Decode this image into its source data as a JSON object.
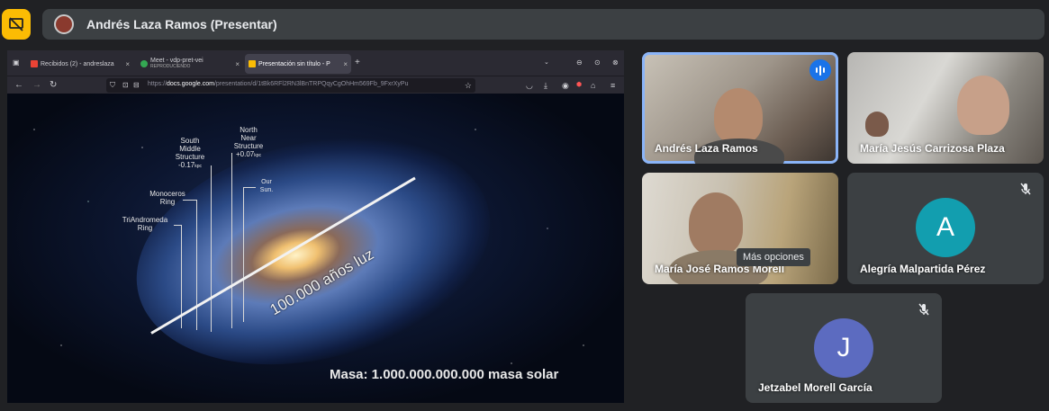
{
  "header": {
    "title": "Andrés Laza Ramos (Presentar)",
    "present_icon": "stop-presenting-icon",
    "accent": "#fbbc04"
  },
  "browser": {
    "tabs": [
      {
        "label": "Recibidos (2) - andreslaza",
        "close": "×",
        "icon": "gmail-icon"
      },
      {
        "label": "Meet - vdp-pret-vei",
        "sublabel": "REPRODUCIENDO",
        "close": "×",
        "icon": "meet-icon"
      },
      {
        "label": "Presentación sin título - P",
        "close": "×",
        "icon": "slides-icon",
        "active": true
      }
    ],
    "new_tab": "+",
    "url_prefix": "https://",
    "url_host": "docs.google.com",
    "url_path": "/presentation/d/1tBk6RFl2RN3lBnTRPQqyCgOhHm569Fb_9FxrXyPu"
  },
  "slide": {
    "labels": {
      "south": "South\nMiddle\nStructure",
      "south_value": "-0.17",
      "south_unit": "kpc",
      "north": "North\nNear\nStructure",
      "north_value": "+0.07",
      "north_unit": "kpc",
      "sun": "Our\nSun.",
      "monoceros": "Monoceros\nRing",
      "triandromeda": "TriAndromeda\nRing"
    },
    "distance": "100.000 años luz",
    "mass": "Masa: 1.000.000.000.000 masa solar"
  },
  "participants": [
    {
      "name": "Andrés Laza Ramos",
      "speaking": true,
      "video": true
    },
    {
      "name": "María Jesús Carrizosa Plaza",
      "video": true
    },
    {
      "name": "María José Ramos Morell",
      "video": true
    },
    {
      "name": "Alegría Malpartida Pérez",
      "initial": "A",
      "color": "#129eaf",
      "muted": true
    },
    {
      "name": "Jetzabel Morell García",
      "initial": "J",
      "color": "#5c6bc0",
      "muted": true
    }
  ],
  "tooltip": "Más opciones"
}
